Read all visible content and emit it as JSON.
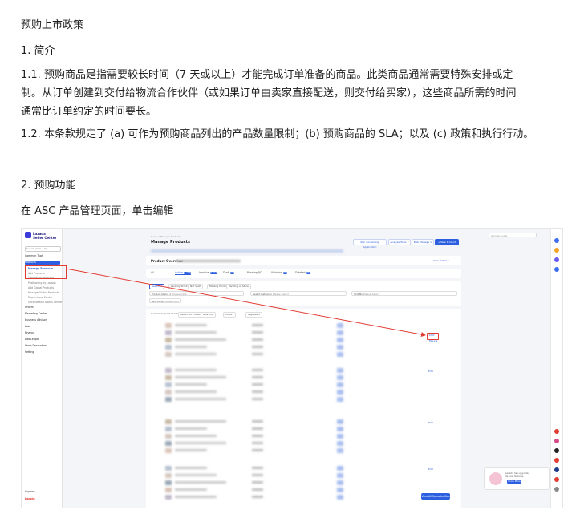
{
  "doc": {
    "title": "预购上市政策",
    "section1": "1. 简介",
    "p11_line1": "1.1. 预购商品是指需要较长时间（7 天或以上）才能完成订单准备的商品。此类商品通常需要特殊安排或定",
    "p11_line2": "制。从订单创建到交付给物流合作伙伴（或如果订单由卖家直接配送，则交付给买家），这些商品所需的时间",
    "p11_line3": "通常比订单约定的时间要长。",
    "p12": "1.2. 本条款规定了 (a) 可作为预购商品列出的产品数量限制；(b) 预购商品的 SLA；以及 (c) 政策和执行行动。",
    "section2": "2. 预购功能",
    "step_text": "在 ASC 产品管理页面，单击编辑"
  },
  "screenshot": {
    "logo_line1": "Lazada",
    "logo_line2": "Seller Center",
    "search_placeholder": "Search (Ctrl + K)",
    "sidebar": [
      {
        "label": "Common Tools",
        "kind": "main"
      },
      {
        "label": "Products",
        "kind": "active"
      },
      {
        "label": "Manage Products",
        "kind": "sub-hl"
      },
      {
        "label": "Add Products",
        "kind": "sub"
      },
      {
        "label": "Decoration Products",
        "kind": "sub"
      },
      {
        "label": "Positioning by Lazada",
        "kind": "sub"
      },
      {
        "label": "Add Global Products",
        "kind": "sub"
      },
      {
        "label": "Manage Global Products",
        "kind": "sub"
      },
      {
        "label": "Repurchase Center",
        "kind": "sub"
      },
      {
        "label": "Secondhand Goods Center",
        "kind": "sub"
      },
      {
        "label": "Orders",
        "kind": "main"
      },
      {
        "label": "Marketing Center",
        "kind": "main"
      },
      {
        "label": "Business Advisor",
        "kind": "main"
      },
      {
        "label": "Lazo",
        "kind": "main"
      },
      {
        "label": "Finance",
        "kind": "main"
      },
      {
        "label": "Add Leapdi",
        "kind": "main"
      },
      {
        "label": "Store Decoration",
        "kind": "main"
      },
      {
        "label": "Setting",
        "kind": "main"
      }
    ],
    "support_label": "Support",
    "bottom_logo": "Lazada",
    "crumb": "Home / Manage Products",
    "page_title": "Manage Products",
    "top_buttons": [
      "Run Containing Application",
      "Analyse Tools ∨",
      "Bulk Manage ∨",
      "+ New Product"
    ],
    "overview_title": "Product Overview",
    "overview_link": "View Detail >",
    "tabs": [
      {
        "label": "All",
        "count": ""
      },
      {
        "label": "Active",
        "count": "1,134"
      },
      {
        "label": "Inactive",
        "count": "1,512"
      },
      {
        "label": "Draft",
        "count": "28"
      },
      {
        "label": "Pending QC",
        "count": ""
      },
      {
        "label": "Violation",
        "count": "28"
      },
      {
        "label": "Deleted",
        "count": "15"
      }
    ],
    "filter_chips": [
      "Selected",
      "Lacking Stock",
      "Not Valid",
      "Missing Product",
      "Pending at Store"
    ],
    "product_name_label": "Product Name ∨",
    "product_name_placeholder": "Please input",
    "category_label": "Select Category",
    "category_placeholder": "Please Select",
    "sort_label": "Sort By",
    "sort_placeholder": "Please Select",
    "sku_label": "SKU Wide",
    "sku_placeholder": "Please input",
    "table_toolbar": [
      "Customize product list",
      "Select All Products",
      "Bulk Edit",
      "Export",
      "Tagaxes ∨"
    ],
    "edit_label": "Edit",
    "more_label": "More ∨",
    "notification_text_1": "Lazada has upgraded",
    "notification_text_2": "its new features",
    "notification_btn": "Know More",
    "view_btn": "View All Opportunities",
    "right_search": "Google Guide"
  }
}
